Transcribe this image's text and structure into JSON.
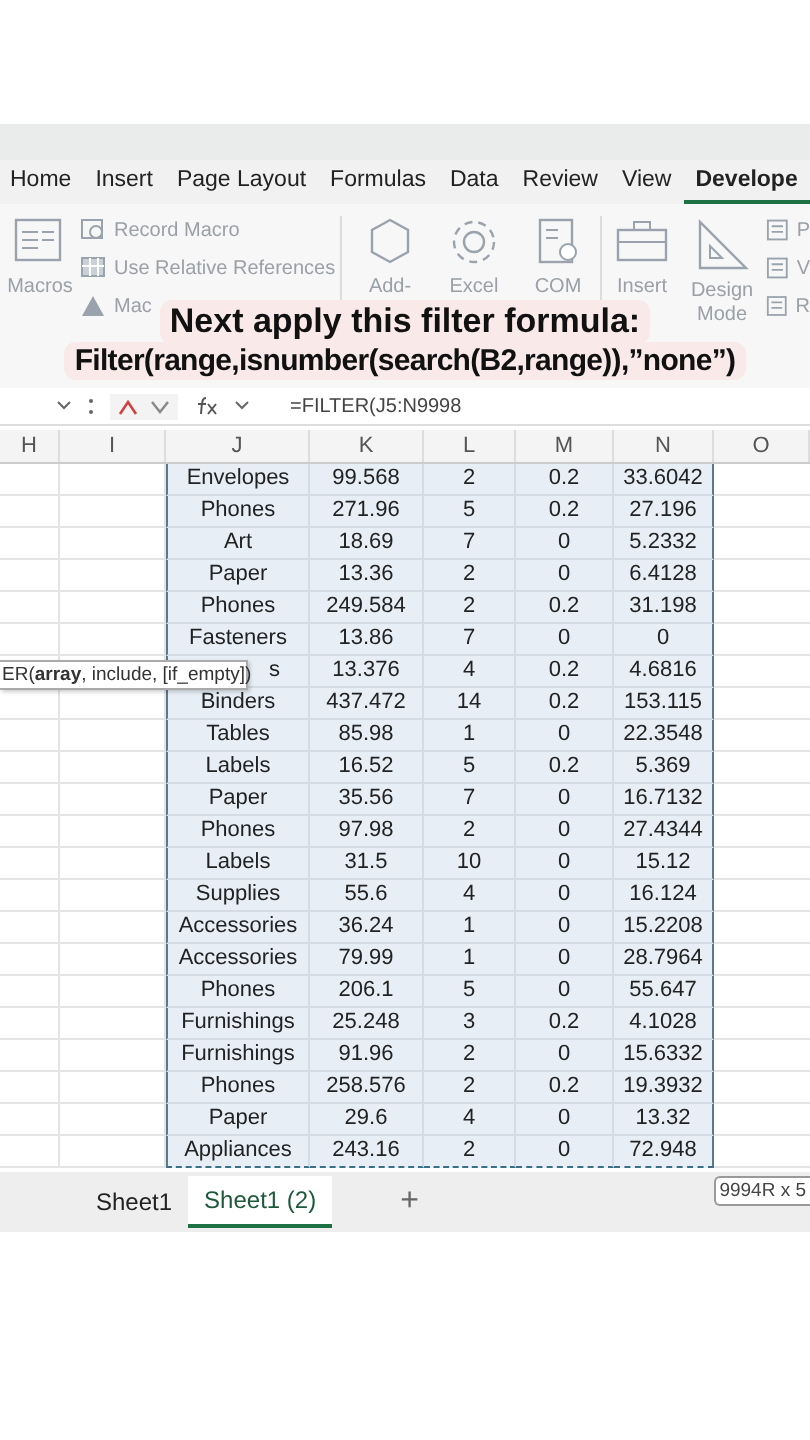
{
  "ribbon_tabs": [
    {
      "label": "Home",
      "selected": false
    },
    {
      "label": "Insert",
      "selected": false
    },
    {
      "label": "Page Layout",
      "selected": false
    },
    {
      "label": "Formulas",
      "selected": false
    },
    {
      "label": "Data",
      "selected": false
    },
    {
      "label": "Review",
      "selected": false
    },
    {
      "label": "View",
      "selected": false
    },
    {
      "label": "Develope",
      "selected": true
    }
  ],
  "ribbon": {
    "macros": "Macros",
    "record_macro": "Record Macro",
    "relative_refs": "Use Relative References",
    "macro_security": "Mac",
    "add_ins": "Add-",
    "excel": "Excel",
    "com": "COM",
    "insert": "Insert",
    "design_mode": [
      "Design",
      "Mode"
    ],
    "side_items": [
      "P",
      "V",
      "R"
    ]
  },
  "caption": {
    "line_1": "Next apply this filter formula:",
    "line_2": "Filter(range,isnumber(search(B2,range)),”none”)"
  },
  "formula_bar": {
    "formula": "=FILTER(J5:N9998"
  },
  "columns": [
    "H",
    "I",
    "J",
    "K",
    "L",
    "M",
    "N",
    "O"
  ],
  "rows": [
    {
      "cells": [
        "Envelopes",
        "99.568",
        "2",
        "0.2",
        "33.6042"
      ]
    },
    {
      "cells": [
        "Phones",
        "271.96",
        "5",
        "0.2",
        "27.196"
      ]
    },
    {
      "cells": [
        "Art",
        "18.69",
        "7",
        "0",
        "5.2332"
      ]
    },
    {
      "cells": [
        "Paper",
        "13.36",
        "2",
        "0",
        "6.4128"
      ]
    },
    {
      "cells": [
        "Phones",
        "249.584",
        "2",
        "0.2",
        "31.198"
      ]
    },
    {
      "cells": [
        "Fasteners",
        "13.86",
        "7",
        "0",
        "0"
      ]
    },
    {
      "cells": [
        "s",
        "13.376",
        "4",
        "0.2",
        "4.6816"
      ],
      "tooltip": "ER(**array**, include, [if_empty])"
    },
    {
      "cells": [
        "Binders",
        "437.472",
        "14",
        "0.2",
        "153.115"
      ]
    },
    {
      "cells": [
        "Tables",
        "85.98",
        "1",
        "0",
        "22.3548"
      ]
    },
    {
      "cells": [
        "Labels",
        "16.52",
        "5",
        "0.2",
        "5.369"
      ]
    },
    {
      "cells": [
        "Paper",
        "35.56",
        "7",
        "0",
        "16.7132"
      ]
    },
    {
      "cells": [
        "Phones",
        "97.98",
        "2",
        "0",
        "27.4344"
      ]
    },
    {
      "cells": [
        "Labels",
        "31.5",
        "10",
        "0",
        "15.12"
      ]
    },
    {
      "cells": [
        "Supplies",
        "55.6",
        "4",
        "0",
        "16.124"
      ]
    },
    {
      "cells": [
        "Accessories",
        "36.24",
        "1",
        "0",
        "15.2208"
      ]
    },
    {
      "cells": [
        "Accessories",
        "79.99",
        "1",
        "0",
        "28.7964"
      ]
    },
    {
      "cells": [
        "Phones",
        "206.1",
        "5",
        "0",
        "55.647"
      ]
    },
    {
      "cells": [
        "Furnishings",
        "25.248",
        "3",
        "0.2",
        "4.1028"
      ]
    },
    {
      "cells": [
        "Furnishings",
        "91.96",
        "2",
        "0",
        "15.6332"
      ]
    },
    {
      "cells": [
        "Phones",
        "258.576",
        "2",
        "0.2",
        "19.3932"
      ]
    },
    {
      "cells": [
        "Paper",
        "29.6",
        "4",
        "0",
        "13.32"
      ]
    },
    {
      "cells": [
        "Appliances",
        "243.16",
        "2",
        "0",
        "72.948"
      ]
    }
  ],
  "sheet_tabs": [
    {
      "label": "Sheet1",
      "selected": false
    },
    {
      "label": "Sheet1 (2)",
      "selected": true
    }
  ],
  "add_sheet": "+",
  "selection_size": "9994R x 5"
}
